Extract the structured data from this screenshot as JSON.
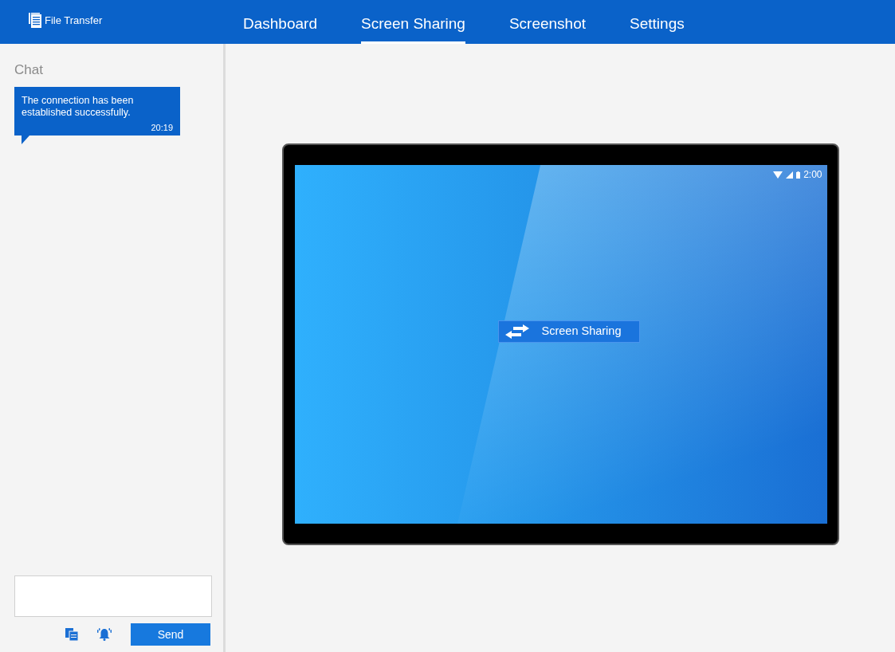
{
  "app": {
    "title": "File Transfer"
  },
  "tabs": [
    {
      "label": "Dashboard",
      "selected": false
    },
    {
      "label": "Screen Sharing",
      "selected": true
    },
    {
      "label": "Screenshot",
      "selected": false
    },
    {
      "label": "Settings",
      "selected": false
    }
  ],
  "chat": {
    "title": "Chat",
    "messages": [
      {
        "text": "The connection has been established successfully.",
        "time": "20:19"
      }
    ],
    "send_label": "Send"
  },
  "device": {
    "status_time": "2:00",
    "action_label": "Screen Sharing"
  }
}
